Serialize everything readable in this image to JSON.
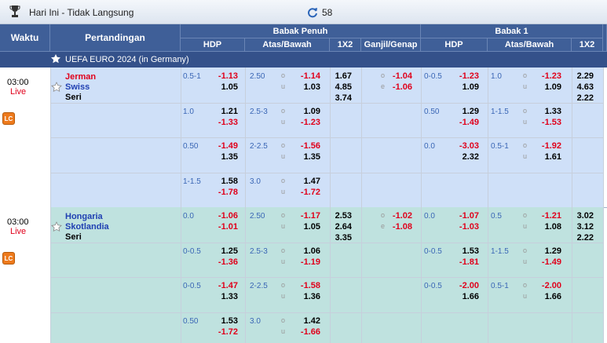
{
  "app": {
    "title": "Hari Ini - Tidak Langsung",
    "count": "58"
  },
  "headers": {
    "time": "Waktu",
    "match": "Pertandingan",
    "full": "Babak Penuh",
    "half": "Babak 1",
    "hdp": "HDP",
    "ou": "Atas/Bawah",
    "x12": "1X2",
    "oe": "Ganjil/Genap"
  },
  "league": {
    "name": "UEFA EURO 2024 (in Germany)"
  },
  "matches": [
    {
      "time": "03:00",
      "status": "Live",
      "home": "Jerman",
      "away": "Swiss",
      "draw": "Seri",
      "lines": [
        {
          "f_hdp": "0.5-1",
          "f_h1": "-1.13",
          "f_h2": "1.05",
          "f_ou": "2.50",
          "f_o1": "-1.14",
          "f_o2": "1.03",
          "h_hdp": "0-0.5",
          "h_h1": "-1.23",
          "h_h2": "1.09",
          "h_ou": "1.0",
          "h_o1": "-1.23",
          "h_o2": "1.09"
        },
        {
          "f_hdp": "1.0",
          "f_h1": "1.21",
          "f_h2": "-1.33",
          "f_ou": "2.5-3",
          "f_o1": "1.09",
          "f_o2": "-1.23",
          "h_hdp": "0.50",
          "h_h1": "1.29",
          "h_h2": "-1.49",
          "h_ou": "1-1.5",
          "h_o1": "1.33",
          "h_o2": "-1.53"
        },
        {
          "f_hdp": "0.50",
          "f_h1": "-1.49",
          "f_h2": "1.35",
          "f_ou": "2-2.5",
          "f_o1": "-1.56",
          "f_o2": "1.35",
          "h_hdp": "0.0",
          "h_h1": "-3.03",
          "h_h2": "2.32",
          "h_ou": "0.5-1",
          "h_o1": "-1.92",
          "h_o2": "1.61"
        },
        {
          "f_hdp": "1-1.5",
          "f_h1": "1.58",
          "f_h2": "-1.78",
          "f_ou": "3.0",
          "f_o1": "1.47",
          "f_o2": "-1.72",
          "h_hdp": "",
          "h_h1": "",
          "h_h2": "",
          "h_ou": "",
          "h_o1": "",
          "h_o2": ""
        }
      ],
      "f_x12": [
        "1.67",
        "4.85",
        "3.74"
      ],
      "oe": [
        "-1.04",
        "-1.06"
      ],
      "h_x12": [
        "2.29",
        "4.63",
        "2.22"
      ]
    },
    {
      "time": "03:00",
      "status": "Live",
      "home": "Hongaria",
      "away": "Skotlandia",
      "draw": "Seri",
      "lines": [
        {
          "f_hdp": "0.0",
          "f_h1": "-1.06",
          "f_h2": "-1.01",
          "f_ou": "2.50",
          "f_o1": "-1.17",
          "f_o2": "1.05",
          "h_hdp": "0.0",
          "h_h1": "-1.07",
          "h_h2": "-1.03",
          "h_ou": "0.5",
          "h_o1": "-1.21",
          "h_o2": "1.08"
        },
        {
          "f_hdp": "0-0.5",
          "f_h1": "1.25",
          "f_h2": "-1.36",
          "f_ou": "2.5-3",
          "f_o1": "1.06",
          "f_o2": "-1.19",
          "h_hdp": "0-0.5",
          "h_h1": "1.53",
          "h_h2": "-1.81",
          "h_ou": "1-1.5",
          "h_o1": "1.29",
          "h_o2": "-1.49"
        },
        {
          "f_hdp": "0-0.5",
          "f_h1": "-1.47",
          "f_h2": "1.33",
          "f_ou": "2-2.5",
          "f_o1": "-1.58",
          "f_o2": "1.36",
          "h_hdp": "0-0.5",
          "h_h1": "-2.00",
          "h_h2": "1.66",
          "h_ou": "0.5-1",
          "h_o1": "-2.00",
          "h_o2": "1.66"
        },
        {
          "f_hdp": "0.50",
          "f_h1": "1.53",
          "f_h2": "-1.72",
          "f_ou": "3.0",
          "f_o1": "1.42",
          "f_o2": "-1.66",
          "h_hdp": "",
          "h_h1": "",
          "h_h2": "",
          "h_ou": "",
          "h_o1": "",
          "h_o2": ""
        }
      ],
      "f_x12": [
        "2.53",
        "2.64",
        "3.35"
      ],
      "oe": [
        "-1.02",
        "-1.08"
      ],
      "h_x12": [
        "3.02",
        "3.12",
        "2.22"
      ]
    }
  ],
  "labels": {
    "over": "o",
    "under": "u",
    "odd": "o",
    "even": "e",
    "lc": "LC"
  },
  "colors": {
    "header": "#3f5f98",
    "league": "#34518a",
    "row_a": "#cfe0f8",
    "row_b": "#bfe2df",
    "negative": "#e0001b"
  }
}
